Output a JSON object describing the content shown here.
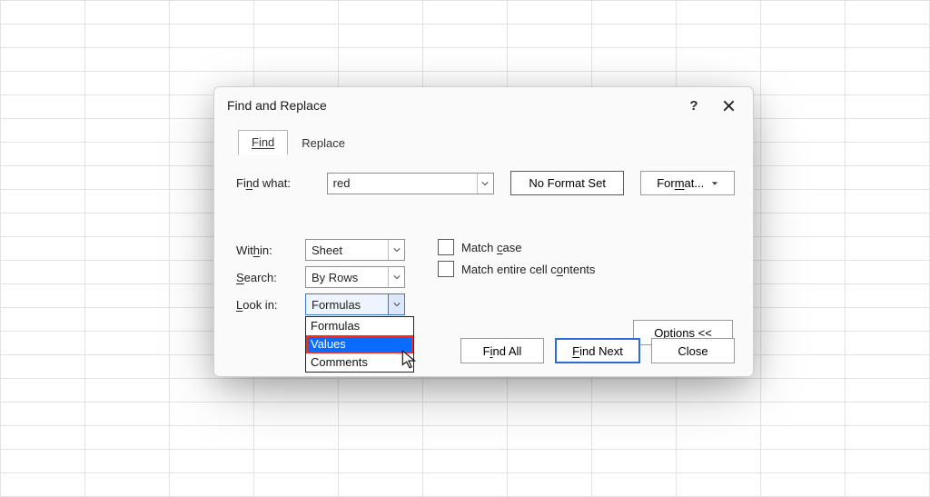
{
  "dialog": {
    "title": "Find and Replace",
    "tabs": {
      "find": "Find",
      "replace": "Replace"
    }
  },
  "findwhat": {
    "label": "Find what:",
    "value": "red"
  },
  "noformat": "No Format Set",
  "format": "Format...",
  "within": {
    "label": "Within:",
    "value": "Sheet"
  },
  "search": {
    "label": "Search:",
    "value": "By Rows"
  },
  "lookin": {
    "label": "Look in:",
    "value": "Formulas"
  },
  "lookin_options": [
    "Formulas",
    "Values",
    "Comments"
  ],
  "checks": {
    "matchcase": "Match case",
    "matchentire": "Match entire cell contents"
  },
  "options_btn": "Options <<",
  "buttons": {
    "findall": "Find All",
    "findnext": "Find Next",
    "close": "Close"
  }
}
